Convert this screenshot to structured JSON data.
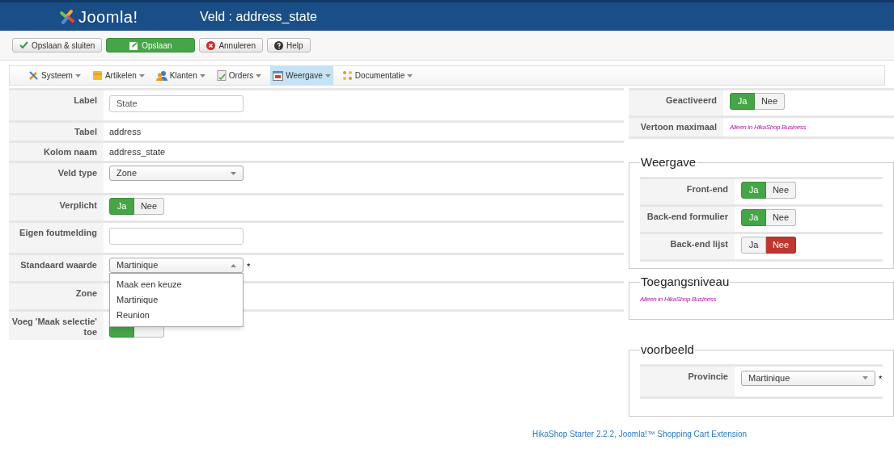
{
  "header": {
    "logo": "Joomla!",
    "title": "Veld : address_state"
  },
  "toolbar": [
    {
      "label": "Opslaan & sluiten",
      "kind": "check",
      "primary": false
    },
    {
      "label": "Opslaan",
      "kind": "edit",
      "primary": true
    },
    {
      "label": "Annuleren",
      "kind": "cancel",
      "primary": false
    },
    {
      "label": "Help",
      "kind": "help",
      "primary": false
    }
  ],
  "menu": [
    {
      "label": "Systeem",
      "kind": "tools",
      "selected": false
    },
    {
      "label": "Artikelen",
      "kind": "box",
      "selected": false
    },
    {
      "label": "Klanten",
      "kind": "users",
      "selected": false
    },
    {
      "label": "Orders",
      "kind": "doc",
      "selected": false
    },
    {
      "label": "Weergave",
      "kind": "window",
      "selected": true
    },
    {
      "label": "Documentatie",
      "kind": "dots",
      "selected": false
    }
  ],
  "form": [
    {
      "label": "Label",
      "kind": "input",
      "value": "State"
    },
    {
      "label": "Tabel",
      "kind": "text",
      "value": "address"
    },
    {
      "label": "Kolom naam",
      "kind": "text",
      "value": "address_state"
    },
    {
      "label": "Veld type",
      "kind": "select",
      "value": "Zone"
    },
    {
      "label": "Verplicht",
      "kind": "toggle",
      "on": true,
      "yes": "Ja",
      "no": "Nee"
    },
    {
      "label": "Eigen foutmelding",
      "kind": "input"
    },
    {
      "label": "Standaard waarde",
      "kind": "dropdown",
      "value": "Martinique",
      "required": "*",
      "options": [
        "Maak een keuze",
        "Martinique",
        "Reunion"
      ]
    },
    {
      "label": "Zone",
      "kind": "covered"
    },
    {
      "label": "Voeg 'Maak selectie' toe",
      "kind": "covered_toggle",
      "on": true
    }
  ],
  "status": [
    {
      "label": "Geactiveerd",
      "kind": "toggle",
      "on": true,
      "yes": "Ja",
      "no": "Nee"
    },
    {
      "label": "Vertoon maximaal",
      "kind": "note",
      "value": "Alleen in HikaShop Business"
    }
  ],
  "weergave": {
    "legend": "Weergave",
    "rows": [
      {
        "label": "Front-end",
        "kind": "toggle",
        "on": true,
        "yes": "Ja",
        "no": "Nee"
      },
      {
        "label": "Back-end formulier",
        "kind": "toggle",
        "on": true,
        "yes": "Ja",
        "no": "Nee"
      },
      {
        "label": "Back-end lijst",
        "kind": "toggle",
        "on": false,
        "yes": "Ja",
        "no": "Nee"
      }
    ]
  },
  "toegang": {
    "legend": "Toegangsniveau",
    "note": "Alleen in HikaShop Business"
  },
  "voorbeeld": {
    "legend": "voorbeeld",
    "rows": [
      {
        "label": "Provincie",
        "kind": "select",
        "value": "Martinique",
        "required": "*"
      }
    ]
  },
  "footer": "HikaShop Starter 2.2.2, Joomla!™ Shopping Cart Extension"
}
